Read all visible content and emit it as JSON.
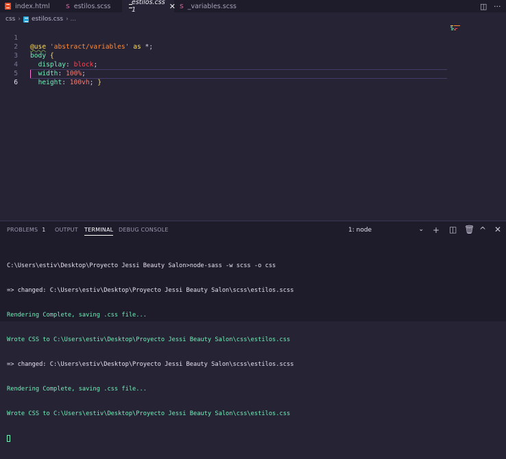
{
  "tabs": [
    {
      "label": "index.html",
      "icon": "html5-icon"
    },
    {
      "label": "estilos.scss",
      "icon": "sass-icon"
    },
    {
      "label": "estilos.css 1",
      "icon": "css3-icon",
      "active": true
    },
    {
      "label": "_variables.scss",
      "icon": "sass-icon"
    }
  ],
  "breadcrumb": {
    "folder": "css",
    "sep": "›",
    "file": "estilos.css",
    "more": "› ..."
  },
  "editor": {
    "line_numbers": [
      "1",
      "2",
      "3",
      "4",
      "5",
      "6"
    ]
  },
  "panel": {
    "tabs": {
      "problems": "PROBLEMS",
      "problems_count": "1",
      "output": "OUTPUT",
      "terminal": "TERMINAL",
      "debug": "DEBUG CONSOLE"
    },
    "terminal_select": "1: node"
  },
  "terminal": {
    "lines": [
      "C:\\Users\\estiv\\Desktop\\Proyecto Jessi Beauty Salon>node-sass -w scss -o css",
      "=> changed: C:\\Users\\estiv\\Desktop\\Proyecto Jessi Beauty Salon\\scss\\estilos.scss",
      "Rendering Complete, saving .css file...",
      "Wrote CSS to C:\\Users\\estiv\\Desktop\\Proyecto Jessi Beauty Salon\\css\\estilos.css",
      "=> changed: C:\\Users\\estiv\\Desktop\\Proyecto Jessi Beauty Salon\\scss\\estilos.scss",
      "Rendering Complete, saving .css file...",
      "Wrote CSS to C:\\Users\\estiv\\Desktop\\Proyecto Jessi Beauty Salon\\css\\estilos.css"
    ]
  },
  "colors": {
    "background": "#262335",
    "accent": "#ff7edb",
    "terminal_green": "#72f1b8"
  }
}
